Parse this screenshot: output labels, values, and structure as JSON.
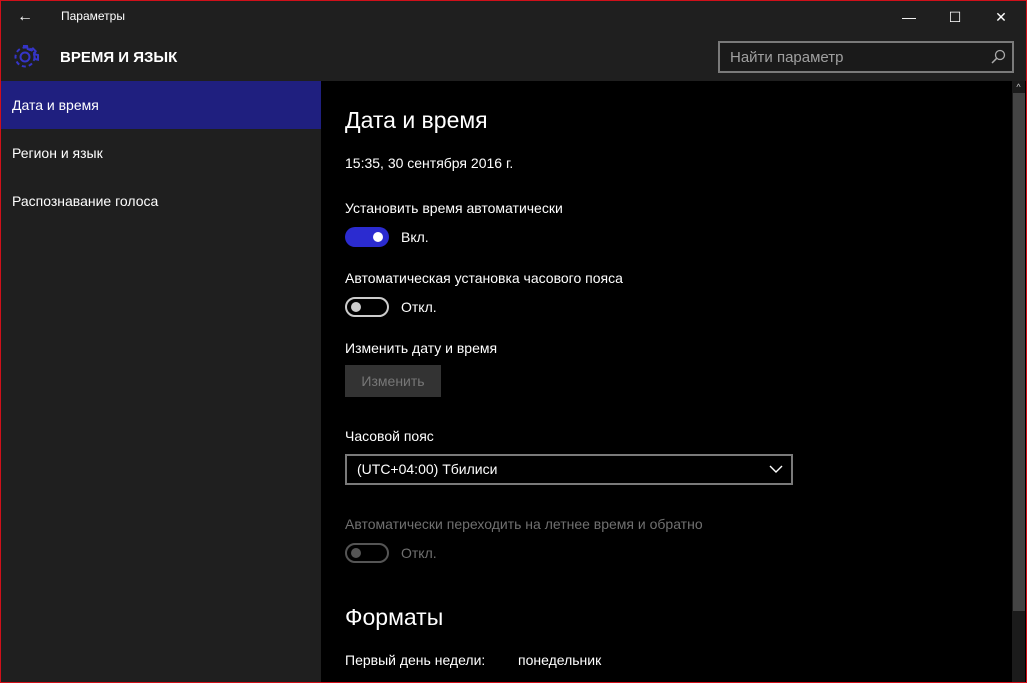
{
  "window": {
    "title": "Параметры",
    "minimize": "—",
    "maximize": "☐",
    "close": "✕",
    "back": "←"
  },
  "header": {
    "section_title": "ВРЕМЯ И ЯЗЫК",
    "search_placeholder": "Найти параметр"
  },
  "sidebar": {
    "items": [
      {
        "label": "Дата и время",
        "active": true
      },
      {
        "label": "Регион и язык"
      },
      {
        "label": "Распознавание голоса"
      }
    ]
  },
  "main": {
    "title": "Дата и время",
    "current_datetime": "15:35, 30 сентября 2016 г.",
    "auto_time": {
      "label": "Установить время автоматически",
      "state": "Вкл."
    },
    "auto_timezone": {
      "label": "Автоматическая установка часового пояса",
      "state": "Откл."
    },
    "change_datetime": {
      "label": "Изменить дату и время",
      "button": "Изменить"
    },
    "timezone": {
      "label": "Часовой пояс",
      "value": "(UTC+04:00) Тбилиси"
    },
    "dst": {
      "label": "Автоматически переходить на летнее время и обратно",
      "state": "Откл."
    },
    "formats": {
      "title": "Форматы",
      "first_day_label": "Первый день недели:",
      "first_day_value": "понедельник"
    }
  },
  "colors": {
    "accent": "#2b2bd0",
    "sidebar_active": "#1f1f7f",
    "border": "#d0101a"
  }
}
